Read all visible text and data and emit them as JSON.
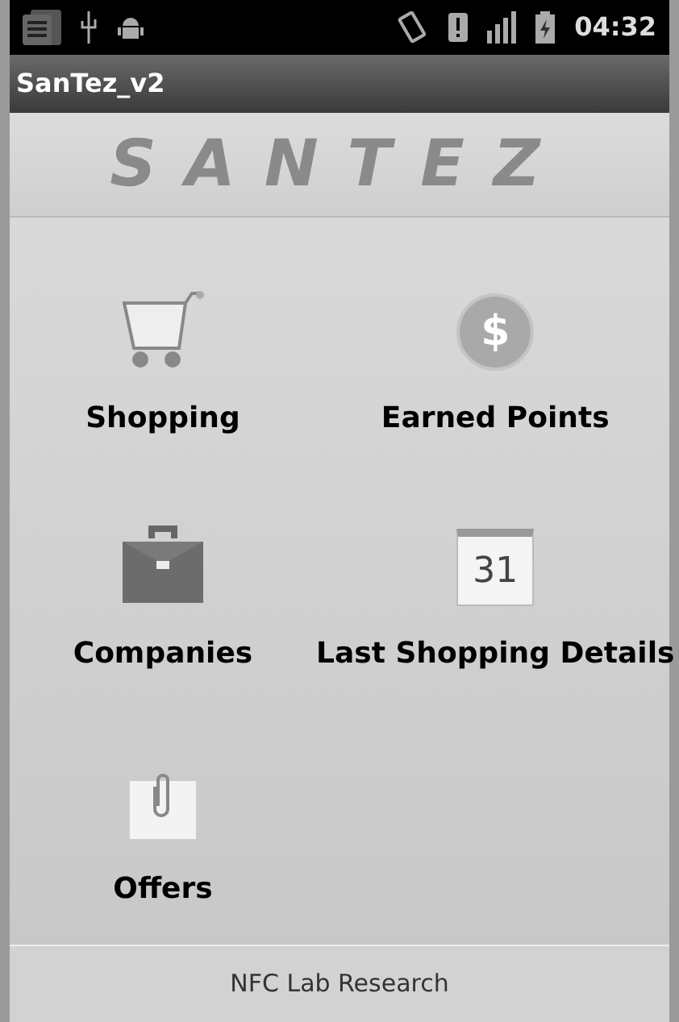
{
  "status_bar": {
    "time": "04:32"
  },
  "window": {
    "title": "SanTez_v2"
  },
  "logo": {
    "text": "SANTEZ"
  },
  "menu": [
    {
      "label": "Shopping",
      "kind": "cart"
    },
    {
      "label": "Earned Points",
      "kind": "coin",
      "badge": "$"
    },
    {
      "label": "Companies",
      "kind": "briefcase"
    },
    {
      "label": "Last Shopping Details",
      "kind": "calendar",
      "badge": "31"
    },
    {
      "label": "Offers",
      "kind": "clip"
    }
  ],
  "footer": {
    "text": "NFC Lab Research"
  }
}
